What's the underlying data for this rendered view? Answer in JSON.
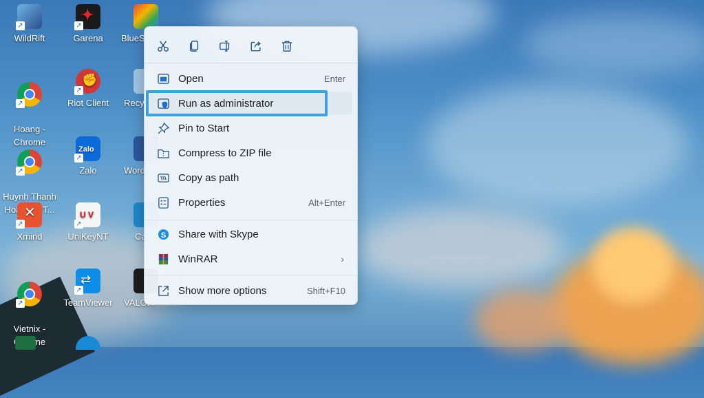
{
  "desktop": {
    "icons": [
      {
        "label": "WildRift"
      },
      {
        "label": "Garena"
      },
      {
        "label": "BlueS"
      },
      {
        "label": "Hoang -\nChrome"
      },
      {
        "label": "Riot Client"
      },
      {
        "label": "Recy"
      },
      {
        "label": "Huynh Thanh\nHoang (HT..."
      },
      {
        "label": "Zalo"
      },
      {
        "label": "Word"
      },
      {
        "label": "Xmind"
      },
      {
        "label": "UniKeyNT"
      },
      {
        "label": "Ca"
      },
      {
        "label": "Vietnix -\nChrome"
      },
      {
        "label": "TeamViewer"
      },
      {
        "label": "VALOR"
      }
    ]
  },
  "menu": {
    "toolbar": [
      "cut-icon",
      "copy-icon",
      "rename-icon",
      "share-icon",
      "delete-icon"
    ],
    "items": [
      {
        "label": "Open",
        "shortcut": "Enter"
      },
      {
        "label": "Run as administrator",
        "shortcut": ""
      },
      {
        "label": "Pin to Start",
        "shortcut": ""
      },
      {
        "label": "Compress to ZIP file",
        "shortcut": ""
      },
      {
        "label": "Copy as path",
        "shortcut": ""
      },
      {
        "label": "Properties",
        "shortcut": "Alt+Enter"
      },
      {
        "label": "Share with Skype",
        "shortcut": ""
      },
      {
        "label": "WinRAR",
        "shortcut": ""
      },
      {
        "label": "Show more options",
        "shortcut": "Shift+F10"
      }
    ]
  },
  "colors": {
    "highlight": "#3aa0e8",
    "accent": "#1f6fd1"
  }
}
